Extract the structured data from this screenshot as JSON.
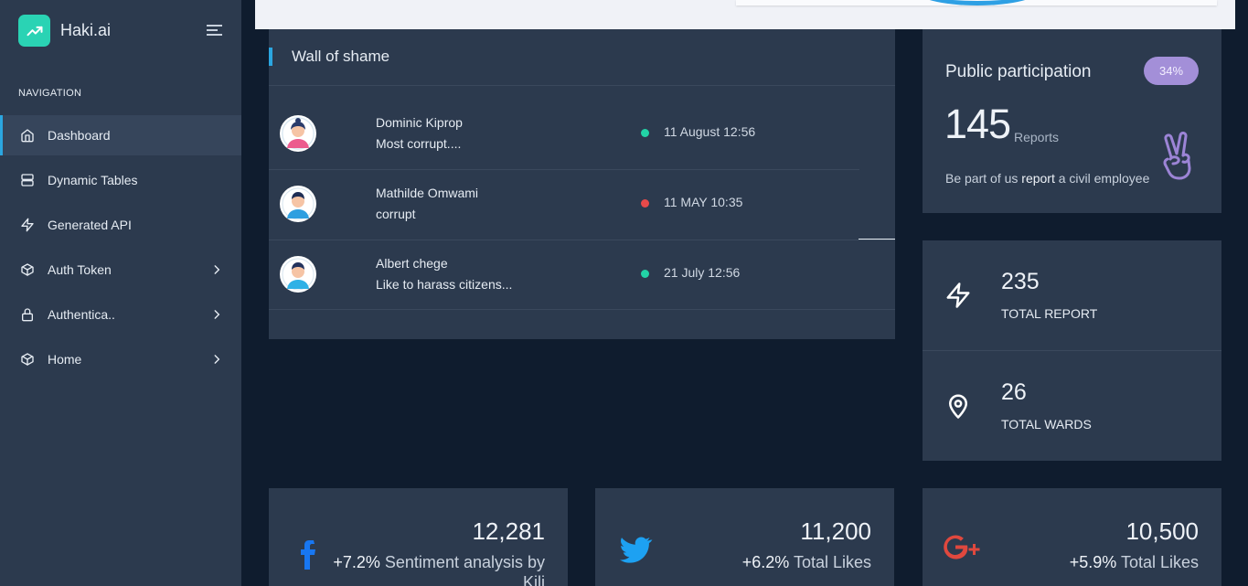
{
  "brand": {
    "name": "Haki.ai",
    "accent": "#2ad3b4"
  },
  "sidebar": {
    "heading": "NAVIGATION",
    "items": [
      {
        "label": "Dashboard",
        "icon": "home-icon",
        "active": true
      },
      {
        "label": "Dynamic Tables",
        "icon": "server-icon"
      },
      {
        "label": "Generated API",
        "icon": "zap-icon"
      },
      {
        "label": "Auth Token",
        "icon": "box-icon",
        "chevron": true
      },
      {
        "label": "Authentica..",
        "icon": "lock-icon",
        "chevron": true
      },
      {
        "label": "Home",
        "icon": "box-icon",
        "chevron": true
      }
    ]
  },
  "wall": {
    "title": "Wall of shame",
    "rows": [
      {
        "name": "Dominic Kiprop",
        "desc": "Most corrupt....",
        "date": "11 August 12:56",
        "status_color": "#22d3a6",
        "avatar": "female-avatar"
      },
      {
        "name": "Mathilde Omwami",
        "desc": "corrupt",
        "date": "11 MAY 10:35",
        "status_color": "#e84a4a",
        "avatar": "male-avatar"
      },
      {
        "name": "Albert chege",
        "desc": "Like to harass citizens...",
        "date": "21 July 12:56",
        "status_color": "#22d3a6",
        "avatar": "male-avatar"
      }
    ]
  },
  "participation": {
    "title": "Public participation",
    "badge": "34%",
    "count": "145",
    "unit": "Reports",
    "text_before": "Be part of us ",
    "text_bold": "report",
    "text_after": " a civil employee",
    "icon": "victory-hand-icon",
    "badge_color": "#a38fd8"
  },
  "stats": [
    {
      "value": "235",
      "label": "TOTAL REPORT",
      "icon": "zap-icon"
    },
    {
      "value": "26",
      "label": "TOTAL WARDS",
      "icon": "map-pin-icon"
    }
  ],
  "social": [
    {
      "network": "facebook",
      "icon": "facebook-icon",
      "value": "12,281",
      "pct": "+7.2%",
      "label": "Sentiment analysis by Kili",
      "color": "#1877f2"
    },
    {
      "network": "twitter",
      "icon": "twitter-icon",
      "value": "11,200",
      "pct": "+6.2%",
      "label": "Total Likes",
      "color": "#1da1f2"
    },
    {
      "network": "google-plus",
      "icon": "google-plus-icon",
      "value": "10,500",
      "pct": "+5.9%",
      "label": "Total Likes",
      "color": "#e0483e"
    }
  ]
}
